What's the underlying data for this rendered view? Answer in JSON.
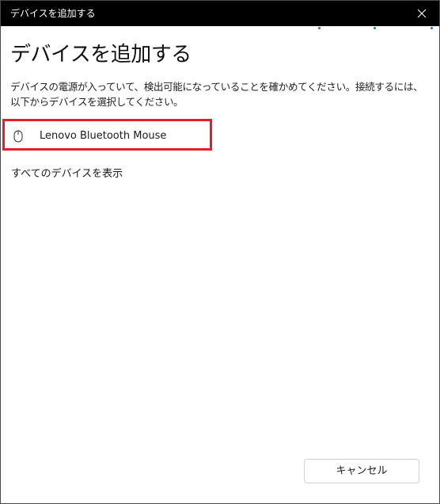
{
  "window": {
    "title": "デバイスを追加する"
  },
  "main": {
    "heading": "デバイスを追加する",
    "description": "デバイスの電源が入っていて、検出可能になっていることを確かめてください。接続するには、以下からデバイスを選択してください。",
    "devices": [
      {
        "name": "Lenovo Bluetooth Mouse",
        "icon": "mouse-icon"
      }
    ],
    "show_all_label": "すべてのデバイスを表示"
  },
  "footer": {
    "cancel_label": "キャンセル"
  },
  "colors": {
    "titlebar": "#000000",
    "highlight_border": "#e0202a",
    "accent_dots": "#2f6fd1"
  }
}
